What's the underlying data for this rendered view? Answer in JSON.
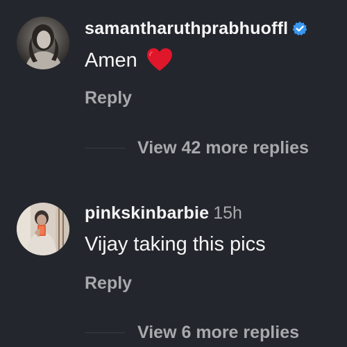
{
  "comments": [
    {
      "username": "samantharuthprabhuoffl",
      "verified": true,
      "timestamp": "",
      "text": "Amen",
      "emoji": "heart-icon",
      "reply_label": "Reply",
      "view_replies_label": "View 42 more replies"
    },
    {
      "username": "pinkskinbarbie",
      "verified": false,
      "timestamp": "15h",
      "text": "Vijay taking this pics",
      "reply_label": "Reply",
      "view_replies_label": "View 6 more replies"
    }
  ],
  "colors": {
    "background": "#24262d",
    "primary_text": "#f5f5f5",
    "secondary_text": "#a8a9ad",
    "verified_badge": "#3897f0",
    "heart": "#e0162b"
  }
}
